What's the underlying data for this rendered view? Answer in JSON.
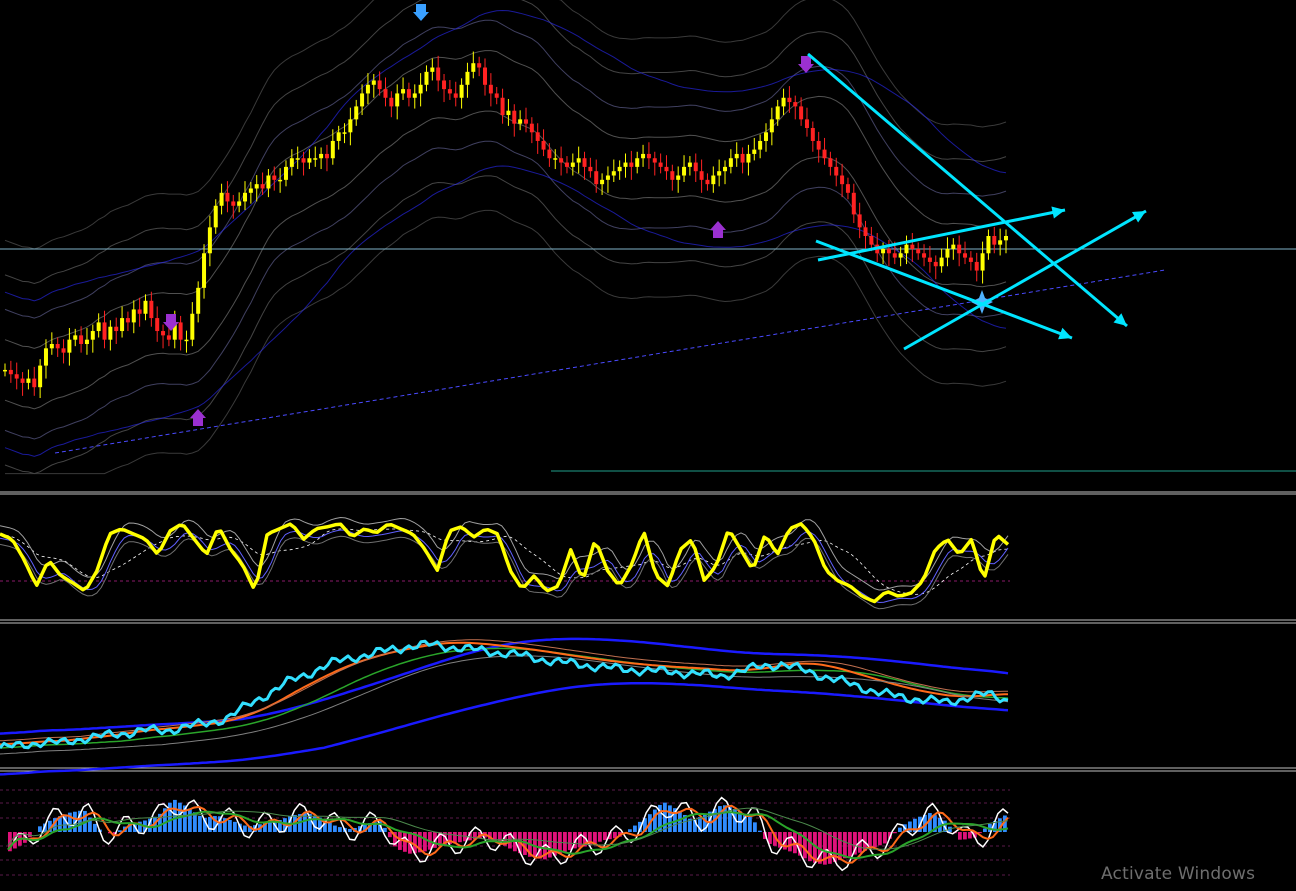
{
  "watermark": "Activate Windows",
  "colors": {
    "background": "#000000",
    "bull_candle": "#ffff00",
    "bear_candle": "#ff2222",
    "trendlines": "#00e5ff",
    "oscillator": "#ffff00",
    "price_ma": "#33e0ff",
    "hist_pos": "#2f8cff",
    "hist_neg": "#e0117a",
    "arrow": "#9b30d0",
    "arrow_top": "#3aa0ff"
  },
  "chart_data": [
    {
      "type": "candlestick",
      "title": "",
      "xlabel": "",
      "ylabel": "",
      "ylim": [
        0,
        100
      ],
      "legend": "none",
      "grid": false,
      "note_series": "close estimates, relative scale (0 = panel bottom, 100 = panel top)",
      "close": [
        19,
        18,
        17,
        16,
        17,
        15,
        20,
        24,
        25,
        24,
        23,
        26,
        27,
        25,
        26,
        28,
        30,
        26,
        29,
        28,
        31,
        30,
        33,
        32,
        35,
        31,
        28,
        27,
        26,
        30,
        26,
        26,
        32,
        38,
        46,
        52,
        57,
        60,
        58,
        57,
        58,
        60,
        61,
        62,
        61,
        64,
        63,
        63,
        66,
        68,
        68,
        67,
        68,
        68,
        69,
        68,
        72,
        74,
        74,
        77,
        80,
        83,
        85,
        86,
        84,
        82,
        80,
        83,
        84,
        82,
        83,
        85,
        88,
        89,
        86,
        84,
        83,
        82,
        85,
        88,
        90,
        89,
        85,
        83,
        82,
        78,
        79,
        76,
        77,
        76,
        74,
        72,
        70,
        68,
        68,
        67,
        66,
        67,
        68,
        66,
        65,
        62,
        63,
        64,
        65,
        66,
        67,
        66,
        68,
        69,
        68,
        67,
        66,
        65,
        63,
        64,
        66,
        67,
        65,
        63,
        62,
        64,
        65,
        66,
        68,
        69,
        67,
        69,
        70,
        72,
        74,
        77,
        80,
        82,
        81,
        80,
        77,
        75,
        72,
        70,
        68,
        66,
        64,
        62,
        60,
        55,
        52,
        50,
        48,
        46,
        47,
        46,
        45,
        46,
        48,
        47,
        46,
        45,
        44,
        43,
        45,
        47,
        48,
        46,
        45,
        44,
        42,
        46,
        50,
        48,
        49,
        50
      ]
    },
    {
      "type": "line",
      "title": "",
      "ylim": [
        0,
        100
      ],
      "legend": "none",
      "series": [
        {
          "values": [
            75,
            70,
            50,
            25,
            50,
            35,
            28,
            20,
            40,
            75,
            80,
            75,
            70,
            55,
            78,
            85,
            70,
            55,
            82,
            60,
            45,
            20,
            75,
            80,
            85,
            70,
            80,
            82,
            85,
            72,
            80,
            76,
            85,
            80,
            75,
            60,
            40,
            78,
            82,
            72,
            80,
            75,
            40,
            22,
            35,
            20,
            25,
            60,
            30,
            70,
            40,
            25,
            45,
            78,
            35,
            25,
            60,
            70,
            30,
            45,
            80,
            60,
            40,
            75,
            55,
            80,
            85,
            70,
            40,
            30,
            25,
            15,
            10,
            20,
            15,
            18,
            30,
            60,
            70,
            55,
            70,
            30,
            75,
            65
          ]
        }
      ]
    },
    {
      "type": "line",
      "title": "",
      "ylim": [
        0,
        100
      ],
      "legend": "none",
      "series": [
        {
          "values": [
            10,
            12,
            15,
            14,
            18,
            20,
            22,
            25,
            24,
            28,
            30,
            35,
            45,
            55,
            65,
            72,
            80,
            85,
            88,
            92,
            95,
            96,
            94,
            92,
            90,
            88,
            85,
            82,
            80,
            78,
            76,
            75,
            74,
            73,
            72,
            70,
            74,
            78,
            80,
            75,
            70,
            65,
            60,
            55,
            52,
            50,
            48,
            52,
            55,
            50
          ]
        }
      ]
    },
    {
      "type": "bar",
      "title": "",
      "ylim": [
        -100,
        100
      ],
      "legend": "none",
      "values": [
        -35,
        -20,
        10,
        25,
        35,
        40,
        5,
        -5,
        15,
        20,
        30,
        60,
        45,
        25,
        30,
        20,
        10,
        15,
        20,
        30,
        35,
        25,
        10,
        5,
        15,
        20,
        -30,
        -40,
        -35,
        -25,
        -20,
        -15,
        -10,
        -20,
        -35,
        -45,
        -50,
        -40,
        -30,
        -25,
        -15,
        -10,
        10,
        30,
        55,
        40,
        20,
        35,
        50,
        40,
        25,
        -20,
        -30,
        -40,
        -55,
        -60,
        -50,
        -40,
        -30,
        -20,
        10,
        25,
        35,
        20,
        -15,
        -10,
        15,
        30
      ]
    }
  ]
}
